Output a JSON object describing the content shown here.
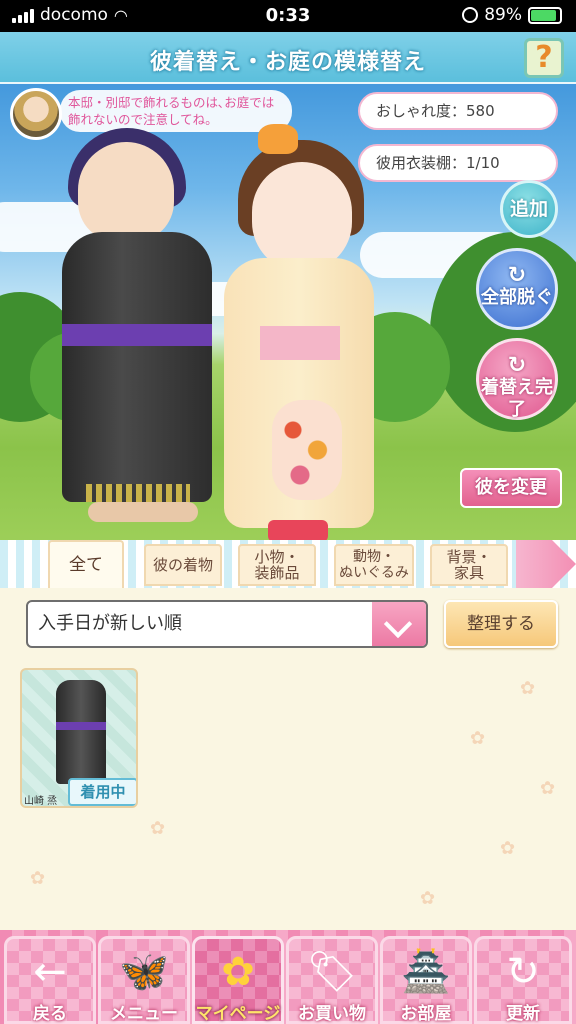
{
  "status_bar": {
    "carrier": "docomo",
    "time": "0:33",
    "battery": "89%",
    "battery_level": 0.89
  },
  "header": {
    "title": "彼着替え・お庭の模様替え",
    "help_label": "?"
  },
  "hint": {
    "message": "本邸・別邸で飾れるものは､お庭では飾れないので注意してね。"
  },
  "stats": {
    "fashion": "おしゃれ度：580",
    "wardrobe": "彼用衣装棚：1/10"
  },
  "actions": {
    "add": "追加",
    "undress_all": "全部脱ぐ",
    "finish": "着替え完了",
    "change_partner": "彼を変更"
  },
  "tabs": [
    {
      "label": "全て"
    },
    {
      "label": "彼の着物"
    },
    {
      "label": "小物・\n装飾品"
    },
    {
      "label": "動物・\nぬいぐるみ"
    },
    {
      "label": "背景・\n家具"
    }
  ],
  "sort": {
    "selected": "入手日が新しい順",
    "organize_label": "整理する"
  },
  "items": [
    {
      "owner": "山崎 烝",
      "badge": "着用中"
    }
  ],
  "nav": [
    {
      "label": "戻る",
      "icon": "back-arrow-icon",
      "glyph": "←"
    },
    {
      "label": "メニュー",
      "icon": "butterfly-icon",
      "glyph": "🦋"
    },
    {
      "label": "マイページ",
      "icon": "flower-icon",
      "glyph": "✿"
    },
    {
      "label": "お買い物",
      "icon": "shopping-tag-icon",
      "glyph": "🏷"
    },
    {
      "label": "お部屋",
      "icon": "room-icon",
      "glyph": "🏯"
    },
    {
      "label": "更新",
      "icon": "refresh-icon",
      "glyph": "↻"
    }
  ],
  "colors": {
    "accent_pink": "#e0588f",
    "accent_blue": "#3fb3c9",
    "title_bar": "#5bbfdc"
  }
}
